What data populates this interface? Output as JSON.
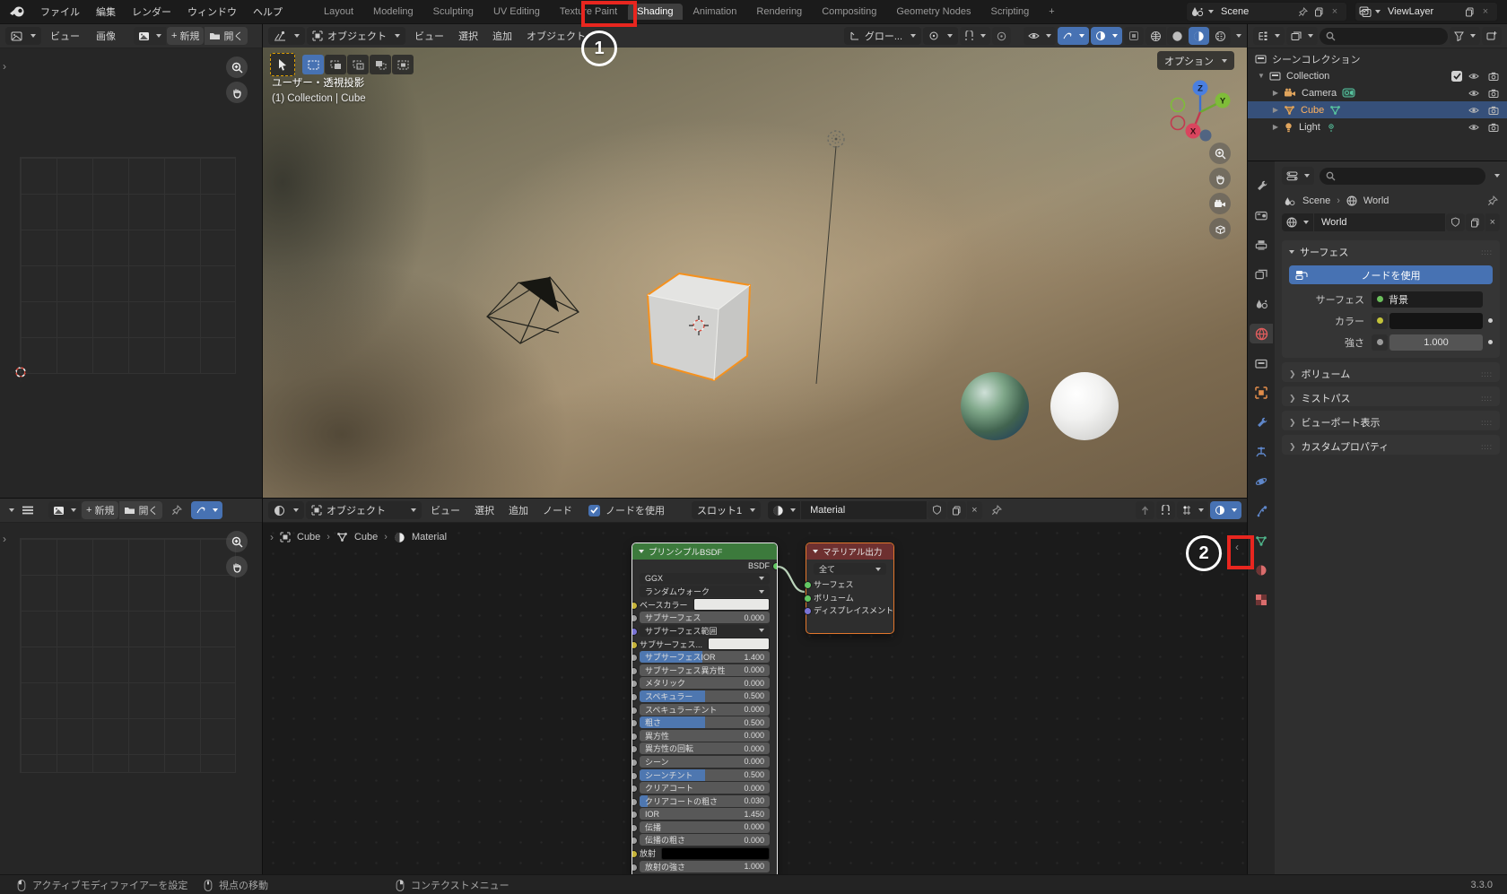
{
  "topbar": {
    "app_menus": [
      "ファイル",
      "編集",
      "レンダー",
      "ウィンドウ",
      "ヘルプ"
    ],
    "workspaces": [
      "Layout",
      "Modeling",
      "Sculpting",
      "UV Editing",
      "Texture Paint",
      "Shading",
      "Animation",
      "Rendering",
      "Compositing",
      "Geometry Nodes",
      "Scripting",
      "+"
    ],
    "active_workspace": "Shading",
    "scene_name": "Scene",
    "viewlayer_name": "ViewLayer"
  },
  "annotations": {
    "step1": "1",
    "step2": "2",
    "box_color": "#e8261f"
  },
  "image_editor_top": {
    "menus": [
      "ビュー",
      "画像"
    ],
    "new_label": "新規",
    "open_label": "開く"
  },
  "image_editor_bottom": {
    "new_label": "新規",
    "open_label": "開く"
  },
  "viewport": {
    "mode": "オブジェクト",
    "menus": [
      "ビュー",
      "選択",
      "追加",
      "オブジェクト"
    ],
    "orientation": "グロー...",
    "options_label": "オプション",
    "overlay_line1": "ユーザー・透視投影",
    "overlay_line2": "(1) Collection | Cube",
    "axis": {
      "x": "X",
      "y": "Y",
      "z": "Z"
    }
  },
  "outliner": {
    "title": "シーンコレクション",
    "rows": [
      {
        "label": "Collection",
        "icon": "collection-icon",
        "expander": "▼",
        "checkbox": true,
        "depth": 0,
        "selected": false
      },
      {
        "label": "Camera",
        "icon": "camera-object-icon",
        "badge": "camera-data-icon",
        "expander": "▶",
        "depth": 1,
        "selected": false
      },
      {
        "label": "Cube",
        "icon": "mesh-object-icon",
        "badge": "mesh-data-icon",
        "expander": "▶",
        "depth": 1,
        "selected": true
      },
      {
        "label": "Light",
        "icon": "light-object-icon",
        "badge": "light-data-icon",
        "expander": "▶",
        "depth": 1,
        "selected": false
      }
    ]
  },
  "properties": {
    "breadcrumb": {
      "scene": "Scene",
      "world": "World"
    },
    "world_name": "World",
    "tabs": [
      "tool",
      "render",
      "output",
      "view-layer",
      "scene",
      "world",
      "collection",
      "object",
      "modifiers",
      "constraints",
      "physics",
      "particles",
      "object-data",
      "material",
      "texture"
    ],
    "active_tab": "world",
    "surface_panel": {
      "title": "サーフェス",
      "use_nodes": "ノードを使用",
      "surface_label": "サーフェス",
      "surface_value": "背景",
      "color_label": "カラー",
      "strength_label": "強さ",
      "strength_value": "1.000"
    },
    "collapsed_panels": [
      "ボリューム",
      "ミストパス",
      "ビューポート表示",
      "カスタムプロパティ"
    ]
  },
  "shader_editor": {
    "mode": "オブジェクト",
    "menus": [
      "ビュー",
      "選択",
      "追加",
      "ノード"
    ],
    "use_nodes_label": "ノードを使用",
    "slot_label": "スロット1",
    "material_name": "Material",
    "breadcrumb": [
      "Cube",
      "Cube",
      "Material"
    ]
  },
  "nodes": {
    "bsdf": {
      "title": "プリンシプルBSDF",
      "output_label": "BSDF",
      "dropdown1": "GGX",
      "dropdown2": "ランダムウォーク",
      "rows": [
        {
          "label": "ベースカラー",
          "type": "color",
          "socket": "yellow",
          "swatch": "#e8e8e6"
        },
        {
          "label": "サブサーフェス",
          "type": "slider",
          "value": "0.000",
          "socket": "gray",
          "fill": 0
        },
        {
          "label": "サブサーフェス範囲",
          "type": "dropdown",
          "socket": "purple"
        },
        {
          "label": "サブサーフェス...",
          "type": "color",
          "socket": "yellow",
          "swatch": "#e8e8e6"
        },
        {
          "label": "サブサーフェスIOR",
          "type": "slider",
          "value": "1.400",
          "socket": "gray",
          "fill": 48
        },
        {
          "label": "サブサーフェス異方性",
          "type": "slider",
          "value": "0.000",
          "socket": "gray",
          "fill": 0
        },
        {
          "label": "メタリック",
          "type": "slider",
          "value": "0.000",
          "socket": "gray",
          "fill": 0
        },
        {
          "label": "スペキュラー",
          "type": "slider",
          "value": "0.500",
          "socket": "gray",
          "fill": 50
        },
        {
          "label": "スペキュラーチント",
          "type": "slider",
          "value": "0.000",
          "socket": "gray",
          "fill": 0
        },
        {
          "label": "粗さ",
          "type": "slider",
          "value": "0.500",
          "socket": "gray",
          "fill": 50
        },
        {
          "label": "異方性",
          "type": "slider",
          "value": "0.000",
          "socket": "gray",
          "fill": 0
        },
        {
          "label": "異方性の回転",
          "type": "slider",
          "value": "0.000",
          "socket": "gray",
          "fill": 0
        },
        {
          "label": "シーン",
          "type": "slider",
          "value": "0.000",
          "socket": "gray",
          "fill": 0
        },
        {
          "label": "シーンチント",
          "type": "slider",
          "value": "0.500",
          "socket": "gray",
          "fill": 50
        },
        {
          "label": "クリアコート",
          "type": "slider",
          "value": "0.000",
          "socket": "gray",
          "fill": 0
        },
        {
          "label": "クリアコートの粗さ",
          "type": "slider",
          "value": "0.030",
          "socket": "gray",
          "fill": 6
        },
        {
          "label": "IOR",
          "type": "slider",
          "value": "1.450",
          "socket": "gray",
          "fill": 0
        },
        {
          "label": "伝播",
          "type": "slider",
          "value": "0.000",
          "socket": "gray",
          "fill": 0
        },
        {
          "label": "伝播の粗さ",
          "type": "slider",
          "value": "0.000",
          "socket": "gray",
          "fill": 0
        },
        {
          "label": "放射",
          "type": "color",
          "socket": "yellow",
          "swatch": "#000000"
        },
        {
          "label": "放射の強さ",
          "type": "slider",
          "value": "1.000",
          "socket": "gray",
          "fill": 0
        }
      ]
    },
    "output": {
      "title": "マテリアル出力",
      "dropdown": "全て",
      "inputs": [
        {
          "label": "サーフェス",
          "socket": "green"
        },
        {
          "label": "ボリューム",
          "socket": "green"
        },
        {
          "label": "ディスプレイスメント",
          "socket": "purple"
        }
      ]
    },
    "socket_colors": {
      "yellow": "#c7b43a",
      "gray": "#a1a1a1",
      "purple": "#7a74d6",
      "green": "#63c763"
    },
    "link_color": "#bcd6bc"
  },
  "statusbar": {
    "items": [
      {
        "mouse": "left",
        "label": "アクティブモディファイアーを設定"
      },
      {
        "mouse": "middle",
        "label": "視点の移動"
      },
      {
        "mouse": "right",
        "label": "コンテクストメニュー"
      }
    ],
    "version": "3.3.0"
  },
  "colors": {
    "accent_blue": "#4772b3",
    "select_orange": "#f5911e",
    "annotation_red": "#e8261f",
    "active_text_orange": "#ffb25e"
  }
}
